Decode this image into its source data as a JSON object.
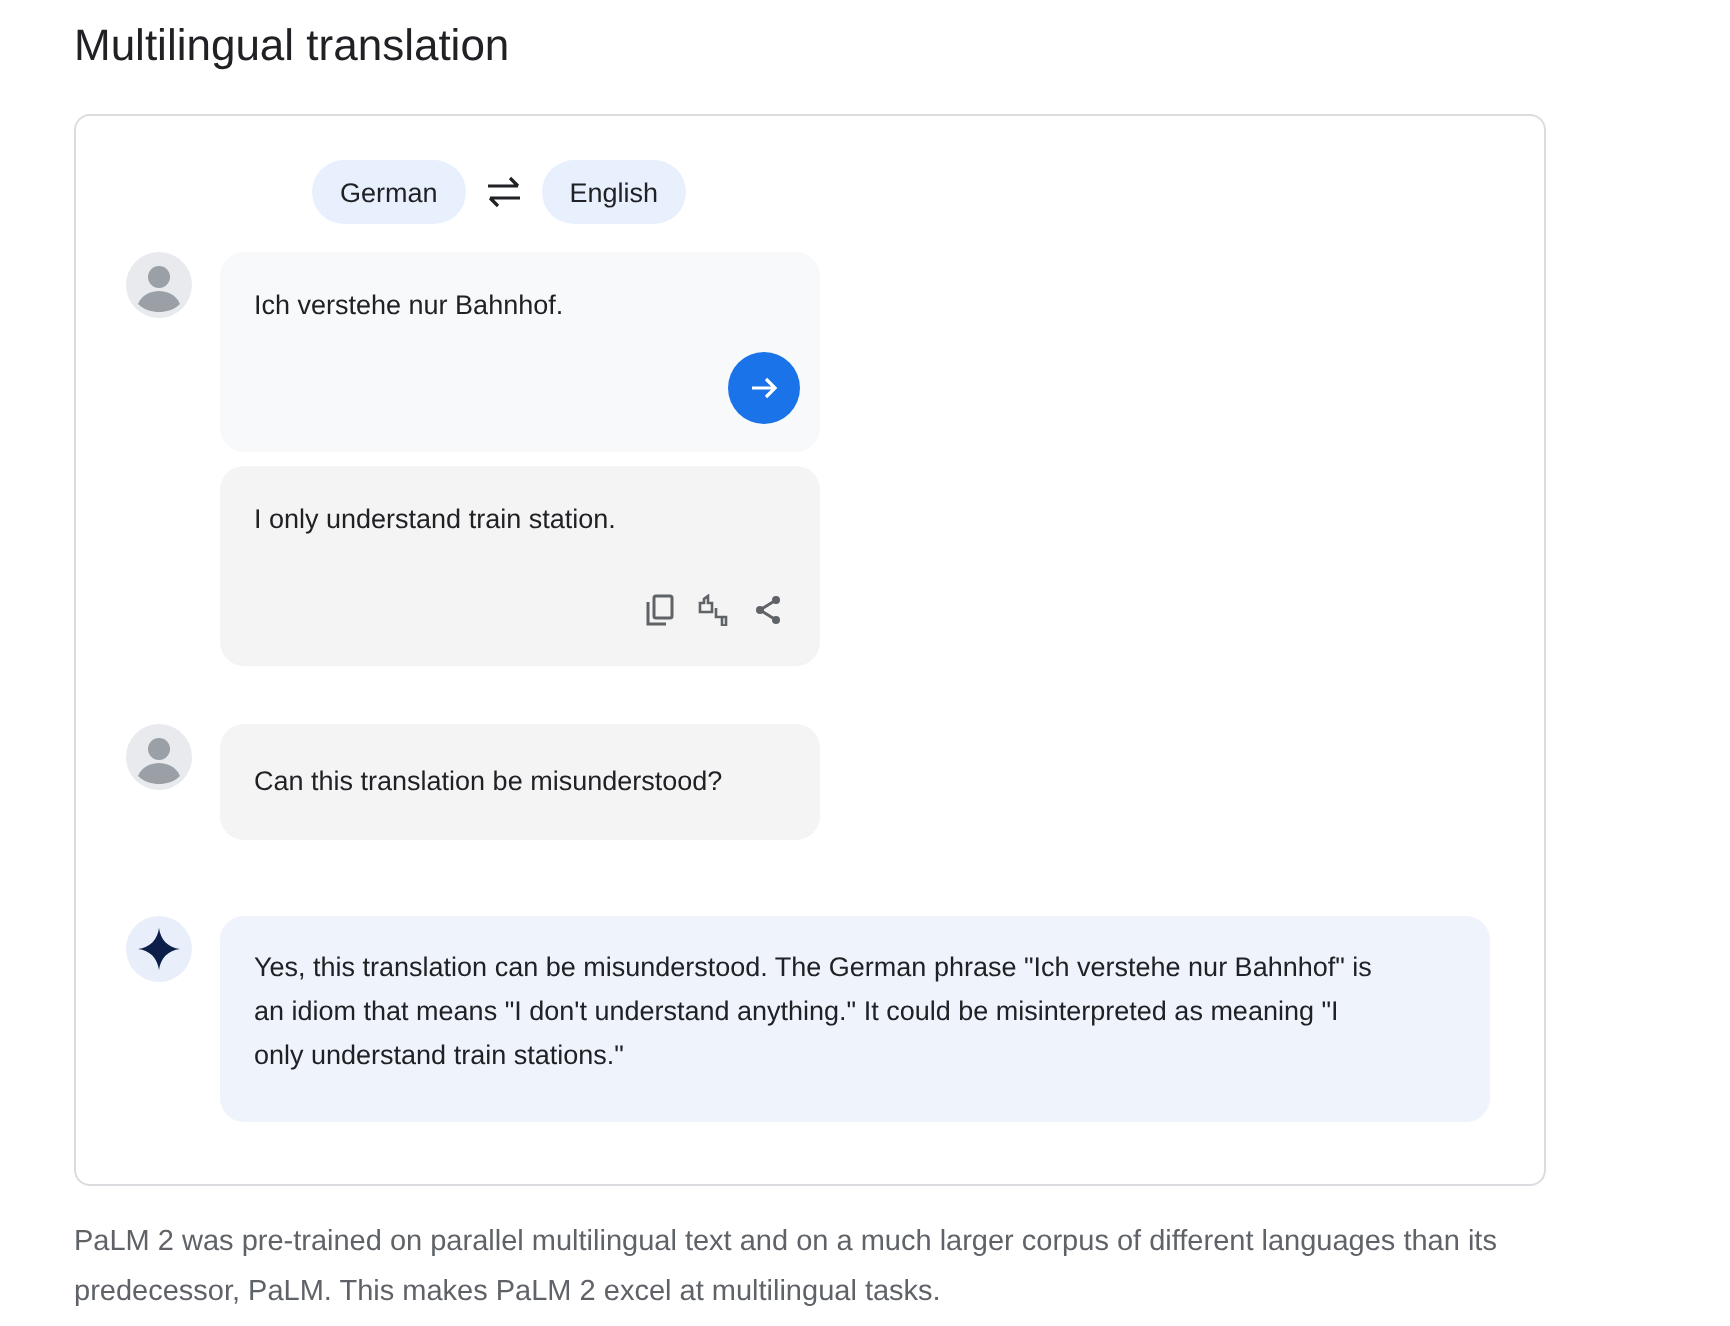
{
  "heading": "Multilingual translation",
  "languages": {
    "source": "German",
    "target": "English"
  },
  "messages": [
    {
      "kind": "input",
      "text": "Ich verstehe nur Bahnhof."
    },
    {
      "kind": "translation",
      "text": "I only understand train station."
    },
    {
      "kind": "user",
      "text": "Can this translation be misunderstood?"
    },
    {
      "kind": "model",
      "text": "Yes, this translation can be misunderstood. The German phrase \"Ich verstehe nur Bahnhof\" is an idiom that means \"I don't understand anything.\" It could be misinterpreted as meaning \"I only understand train stations.\""
    }
  ],
  "footer": "PaLM 2 was pre-trained on parallel multilingual text and on a much larger corpus of different languages than its predecessor, PaLM. This makes PaLM 2 excel at multilingual tasks."
}
